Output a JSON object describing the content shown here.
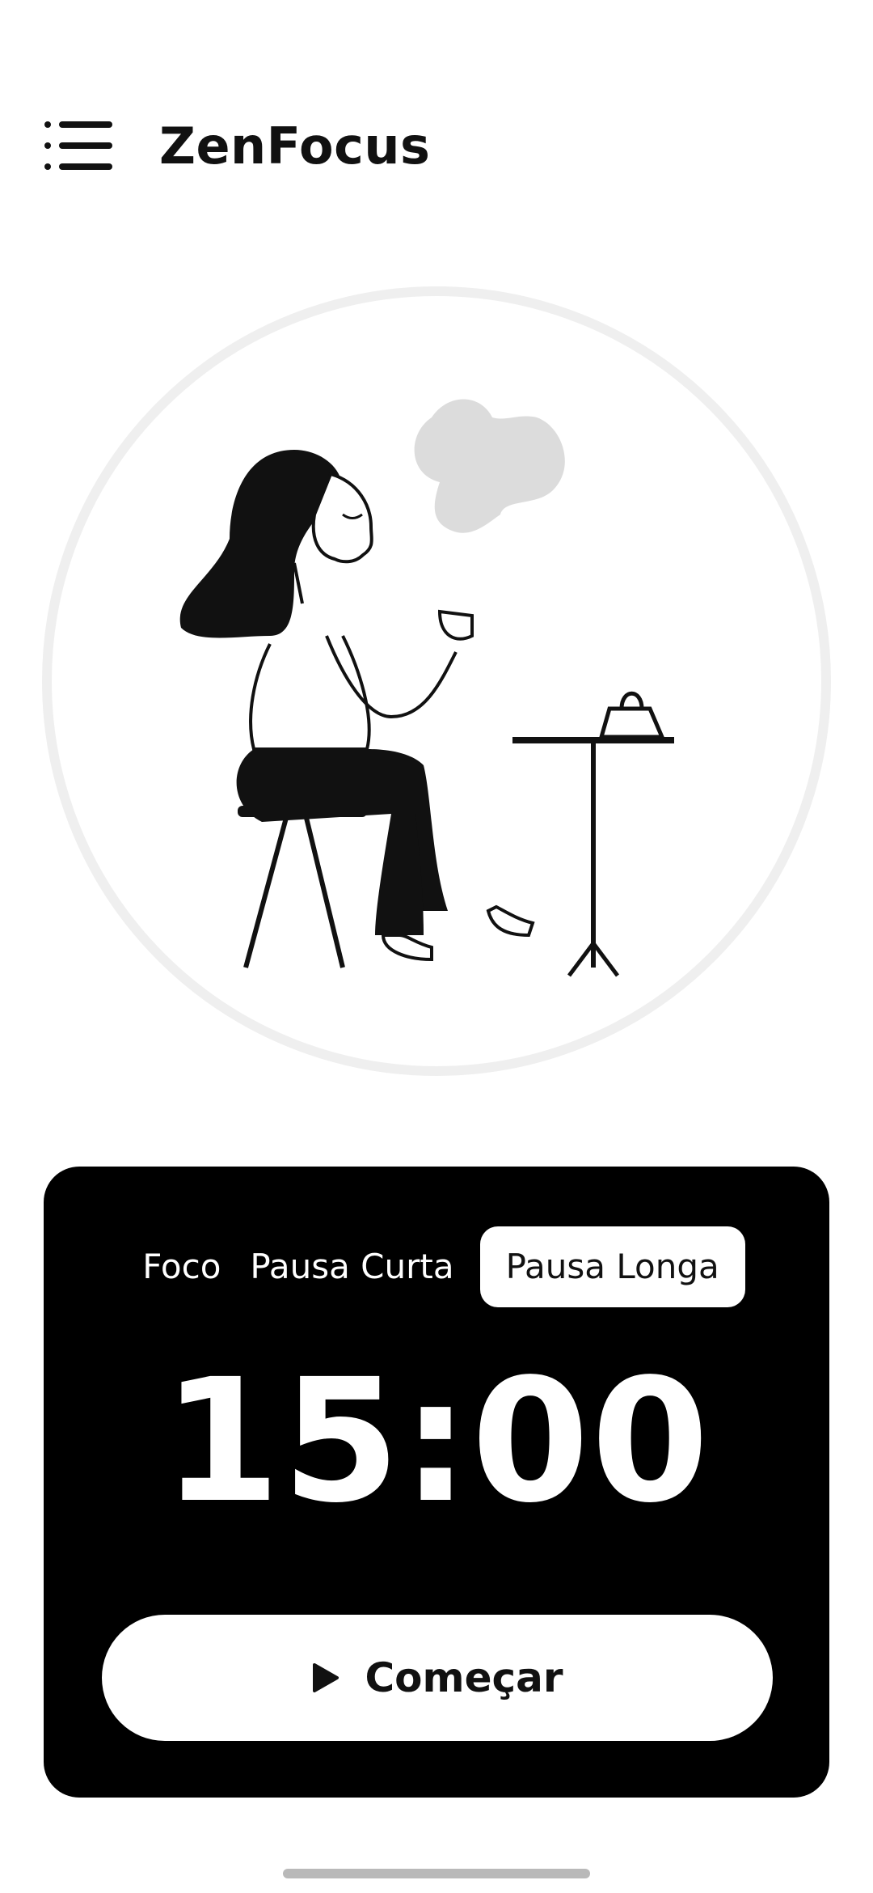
{
  "header": {
    "title": "ZenFocus",
    "menu_icon": "hamburger-menu-icon"
  },
  "illustration": {
    "icon": "woman-drinking-coffee-illustration"
  },
  "timer": {
    "tabs": [
      {
        "label": "Foco",
        "active": false
      },
      {
        "label": "Pausa Curta",
        "active": false
      },
      {
        "label": "Pausa Longa",
        "active": true
      }
    ],
    "time": "15:00",
    "start_label": "Começar",
    "start_icon": "play-icon"
  },
  "colors": {
    "background": "#ffffff",
    "card": "#000000",
    "text_primary": "#111111",
    "circle_border": "#efefef"
  }
}
